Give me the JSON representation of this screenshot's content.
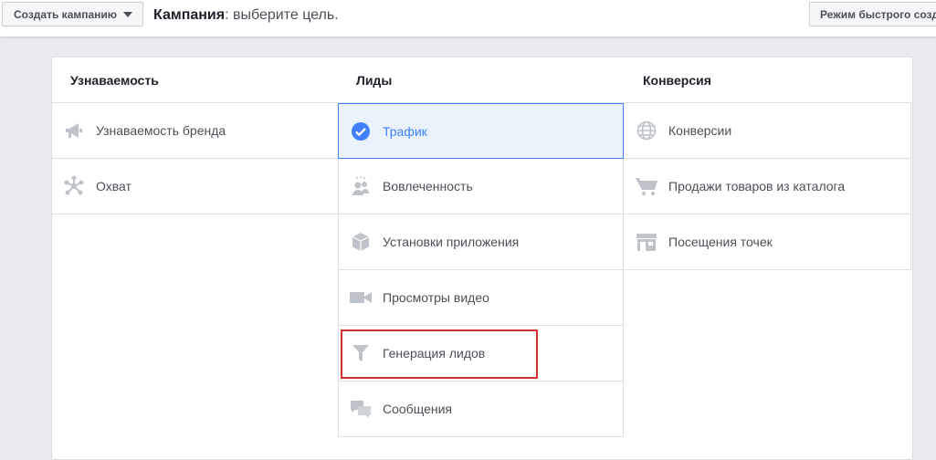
{
  "topbar": {
    "create_label": "Создать кампанию",
    "title_strong": "Кампания",
    "title_rest": ": выберите цель.",
    "quick_label": "Режим быстрого созд"
  },
  "columns": [
    {
      "heading": "Узнаваемость",
      "items": [
        {
          "label": "Узнаваемость бренда",
          "icon": "megaphone-icon"
        },
        {
          "label": "Охват",
          "icon": "reach-icon"
        }
      ]
    },
    {
      "heading": "Лиды",
      "items": [
        {
          "label": "Трафик",
          "icon": "check-circle-icon",
          "selected": true
        },
        {
          "label": "Вовлеченность",
          "icon": "people-icon"
        },
        {
          "label": "Установки приложения",
          "icon": "box-icon"
        },
        {
          "label": "Просмотры видео",
          "icon": "video-camera-icon"
        },
        {
          "label": "Генерация лидов",
          "icon": "funnel-icon"
        },
        {
          "label": "Сообщения",
          "icon": "chat-bubbles-icon"
        }
      ]
    },
    {
      "heading": "Конверсия",
      "items": [
        {
          "label": "Конверсии",
          "icon": "globe-icon"
        },
        {
          "label": "Продажи товаров из каталога",
          "icon": "cart-icon"
        },
        {
          "label": "Посещения точек",
          "icon": "store-icon"
        }
      ]
    }
  ],
  "colors": {
    "accent": "#4080ff",
    "highlight": "#d32f2f",
    "icon_gray": "#bec3c9"
  }
}
